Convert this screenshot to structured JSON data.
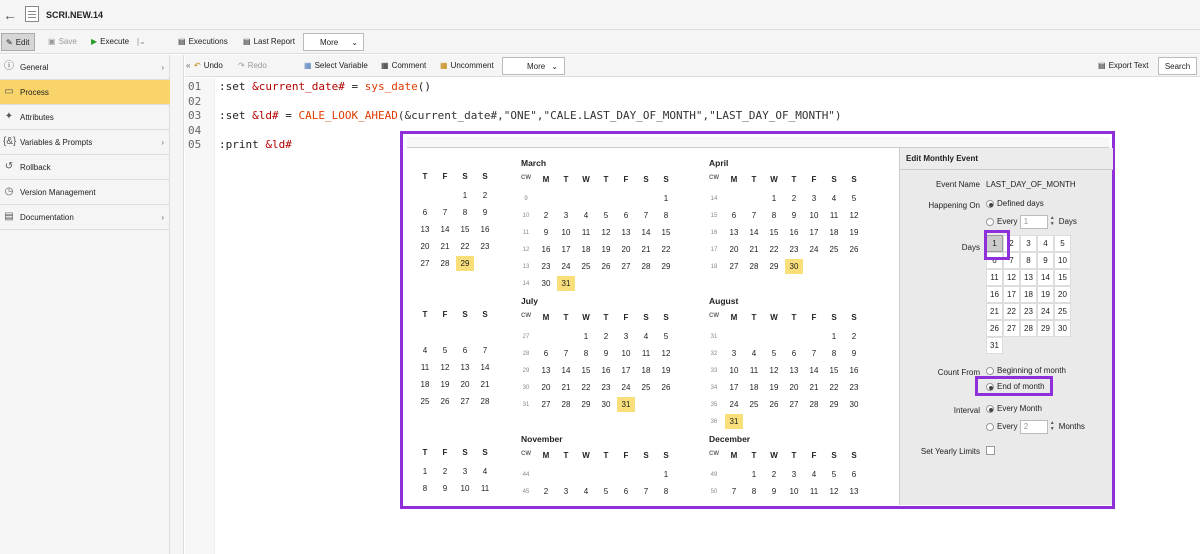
{
  "title": "SCRI.NEW.14",
  "toolbar": {
    "edit": "Edit",
    "save": "Save",
    "execute": "Execute",
    "executions": "Executions",
    "last_report": "Last Report",
    "more": "More"
  },
  "sidebar": [
    {
      "label": "General",
      "icon": "info-icon",
      "arrow": true
    },
    {
      "label": "Process",
      "icon": "document-icon",
      "arrow": false,
      "active": true
    },
    {
      "label": "Attributes",
      "icon": "tools-icon",
      "arrow": false
    },
    {
      "label": "Variables & Prompts",
      "icon": "variable-icon",
      "arrow": true
    },
    {
      "label": "Rollback",
      "icon": "undo-icon",
      "arrow": false
    },
    {
      "label": "Version Management",
      "icon": "history-icon",
      "arrow": false
    },
    {
      "label": "Documentation",
      "icon": "doc-icon",
      "arrow": true
    }
  ],
  "editor_toolbar": {
    "collapse": "«",
    "undo": "Undo",
    "redo": "Redo",
    "select_variable": "Select Variable",
    "comment": "Comment",
    "uncomment": "Uncomment",
    "more": "More",
    "export_text": "Export Text",
    "search": "Search"
  },
  "code": {
    "line_numbers": [
      "01",
      "02",
      "03",
      "04",
      "05"
    ],
    "line1": {
      "kw": ":set ",
      "var": "&current_date#",
      "eq": " = ",
      "fn": "sys_date",
      "rest": "()"
    },
    "line3": {
      "kw": ":set ",
      "var": "&ld#",
      "eq": " = ",
      "fn": "CALE_LOOK_AHEAD",
      "rest": "(&current_date#,\"ONE\",\"CALE.LAST_DAY_OF_MONTH\",\"LAST_DAY_OF_MONTH\")"
    },
    "line5": {
      "kw": ":print ",
      "var": "&ld#"
    }
  },
  "calendar": {
    "weekday_headers": [
      "T",
      "F",
      "S",
      "S"
    ],
    "full_headers": [
      "CW",
      "M",
      "T",
      "W",
      "T",
      "F",
      "S",
      "S"
    ],
    "partial_months": [
      {
        "rows": [
          [
            "",
            "",
            "1",
            "2"
          ],
          [
            "6",
            "7",
            "8",
            "9"
          ],
          [
            "13",
            "14",
            "15",
            "16"
          ],
          [
            "20",
            "21",
            "22",
            "23"
          ],
          [
            "27",
            "28",
            "29",
            ""
          ]
        ],
        "highlight": "29"
      },
      {
        "rows": [
          [
            "",
            "",
            "",
            ""
          ],
          [
            "4",
            "5",
            "6",
            "7"
          ],
          [
            "11",
            "12",
            "13",
            "14"
          ],
          [
            "18",
            "19",
            "20",
            "21"
          ],
          [
            "25",
            "26",
            "27",
            "28"
          ]
        ],
        "highlight": ""
      },
      {
        "rows": [
          [
            "1",
            "2",
            "3",
            "4"
          ],
          [
            "8",
            "9",
            "10",
            "11"
          ]
        ],
        "highlight": ""
      }
    ],
    "months": [
      {
        "name": "March",
        "weeks": [
          {
            "cw": "9",
            "days": [
              "",
              "",
              "",
              "",
              "",
              "",
              "1"
            ]
          },
          {
            "cw": "10",
            "days": [
              "2",
              "3",
              "4",
              "5",
              "6",
              "7",
              "8"
            ]
          },
          {
            "cw": "11",
            "days": [
              "9",
              "10",
              "11",
              "12",
              "13",
              "14",
              "15"
            ]
          },
          {
            "cw": "12",
            "days": [
              "16",
              "17",
              "18",
              "19",
              "20",
              "21",
              "22"
            ]
          },
          {
            "cw": "13",
            "days": [
              "23",
              "24",
              "25",
              "26",
              "27",
              "28",
              "29"
            ]
          },
          {
            "cw": "14",
            "days": [
              "30",
              "31",
              "",
              "",
              "",
              "",
              ""
            ]
          }
        ],
        "highlight": "31"
      },
      {
        "name": "April",
        "weeks": [
          {
            "cw": "14",
            "days": [
              "",
              "",
              "1",
              "2",
              "3",
              "4",
              "5"
            ]
          },
          {
            "cw": "15",
            "days": [
              "6",
              "7",
              "8",
              "9",
              "10",
              "11",
              "12"
            ]
          },
          {
            "cw": "16",
            "days": [
              "13",
              "14",
              "15",
              "16",
              "17",
              "18",
              "19"
            ]
          },
          {
            "cw": "17",
            "days": [
              "20",
              "21",
              "22",
              "23",
              "24",
              "25",
              "26"
            ]
          },
          {
            "cw": "18",
            "days": [
              "27",
              "28",
              "29",
              "30",
              "",
              "",
              ""
            ]
          }
        ],
        "highlight": "30"
      },
      {
        "name": "July",
        "weeks": [
          {
            "cw": "27",
            "days": [
              "",
              "",
              "1",
              "2",
              "3",
              "4",
              "5"
            ]
          },
          {
            "cw": "28",
            "days": [
              "6",
              "7",
              "8",
              "9",
              "10",
              "11",
              "12"
            ]
          },
          {
            "cw": "29",
            "days": [
              "13",
              "14",
              "15",
              "16",
              "17",
              "18",
              "19"
            ]
          },
          {
            "cw": "30",
            "days": [
              "20",
              "21",
              "22",
              "23",
              "24",
              "25",
              "26"
            ]
          },
          {
            "cw": "31",
            "days": [
              "27",
              "28",
              "29",
              "30",
              "31",
              "",
              ""
            ]
          }
        ],
        "highlight": "31"
      },
      {
        "name": "August",
        "weeks": [
          {
            "cw": "31",
            "days": [
              "",
              "",
              "",
              "",
              "",
              "1",
              "2"
            ]
          },
          {
            "cw": "32",
            "days": [
              "3",
              "4",
              "5",
              "6",
              "7",
              "8",
              "9"
            ]
          },
          {
            "cw": "33",
            "days": [
              "10",
              "11",
              "12",
              "13",
              "14",
              "15",
              "16"
            ]
          },
          {
            "cw": "34",
            "days": [
              "17",
              "18",
              "19",
              "20",
              "21",
              "22",
              "23"
            ]
          },
          {
            "cw": "35",
            "days": [
              "24",
              "25",
              "26",
              "27",
              "28",
              "29",
              "30"
            ]
          },
          {
            "cw": "36",
            "days": [
              "31",
              "",
              "",
              "",
              "",
              "",
              ""
            ]
          }
        ],
        "highlight": "31"
      },
      {
        "name": "November",
        "weeks": [
          {
            "cw": "44",
            "days": [
              "",
              "",
              "",
              "",
              "",
              "",
              "1"
            ]
          },
          {
            "cw": "45",
            "days": [
              "2",
              "3",
              "4",
              "5",
              "6",
              "7",
              "8"
            ]
          }
        ],
        "highlight": ""
      },
      {
        "name": "December",
        "weeks": [
          {
            "cw": "49",
            "days": [
              "",
              "1",
              "2",
              "3",
              "4",
              "5",
              "6"
            ]
          },
          {
            "cw": "50",
            "days": [
              "7",
              "8",
              "9",
              "10",
              "11",
              "12",
              "13"
            ]
          }
        ],
        "highlight": ""
      }
    ]
  },
  "panel": {
    "title": "Edit Monthly Event",
    "event_name_label": "Event Name",
    "event_name": "LAST_DAY_OF_MONTH",
    "happening_on_label": "Happening On",
    "defined_days": "Defined days",
    "every": "Every",
    "every_value": "1",
    "days_unit": "Days",
    "days_label": "Days",
    "days": [
      "1",
      "2",
      "3",
      "4",
      "5",
      "6",
      "7",
      "8",
      "9",
      "10",
      "11",
      "12",
      "13",
      "14",
      "15",
      "16",
      "17",
      "18",
      "19",
      "20",
      "21",
      "22",
      "23",
      "24",
      "25",
      "26",
      "27",
      "28",
      "29",
      "30",
      "31"
    ],
    "count_from_label": "Count From",
    "beginning_of_month": "Beginning of month",
    "end_of_month": "End of month",
    "interval_label": "Interval",
    "every_month": "Every Month",
    "every_months_value": "2",
    "months_unit": "Months",
    "yearly_limits_label": "Set Yearly Limits",
    "highlight_color": "#8f2fd9",
    "highlight_day_color": "#f9df7a",
    "active_nav_color": "#f9d46a"
  }
}
